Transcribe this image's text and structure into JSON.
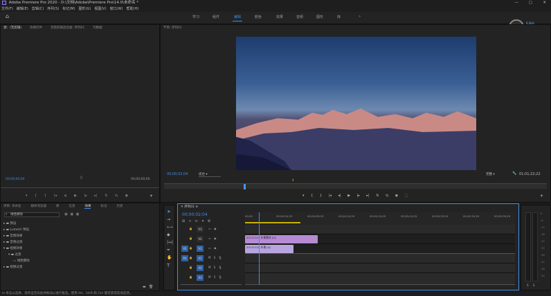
{
  "window": {
    "title": "Adobe Premiere Pro 2020 - D:\\文档\\Adobe\\Premiere Pro\\14.0\\未命名 *"
  },
  "menu": [
    "文件(F)",
    "编辑(E)",
    "剪辑(C)",
    "序列(S)",
    "标记(M)",
    "图形(G)",
    "视图(V)",
    "窗口(W)",
    "帮助(H)"
  ],
  "workspaces": [
    "学习",
    "组件",
    "编辑",
    "颜色",
    "效果",
    "音频",
    "图形",
    "库"
  ],
  "workspace_active_index": 2,
  "badge": {
    "percent": "48",
    "unit": "%",
    "up": "0.2k/s",
    "down": "0k/s"
  },
  "source_panel": {
    "tabs": [
      "源：(无剪辑)",
      "效果控件",
      "音频剪辑混合器: 序列01",
      "元数据"
    ],
    "timecode_left": "00;00;00;00",
    "timecode_right": "00;00;00;00"
  },
  "program_panel": {
    "title": "节目: 序列01",
    "timecode": "00;00;02;04",
    "fit": "适合",
    "quality": "完整",
    "duration": "01;01;22;22",
    "marker": "4"
  },
  "project_panel": {
    "tabs": [
      "项目: 未命名",
      "媒体浏览器",
      "库",
      "信息",
      "效果",
      "标记",
      "历史"
    ],
    "active_tab": "效果",
    "search": "线性擦除",
    "tree": [
      {
        "label": "预设",
        "indent": 0,
        "expanded": false
      },
      {
        "label": "Lumetri 预设",
        "indent": 0,
        "expanded": false
      },
      {
        "label": "音频效果",
        "indent": 0,
        "expanded": false
      },
      {
        "label": "音频过渡",
        "indent": 0,
        "expanded": false
      },
      {
        "label": "视频效果",
        "indent": 0,
        "expanded": true
      },
      {
        "label": "过渡",
        "indent": 1,
        "expanded": true
      },
      {
        "label": "线性擦除",
        "indent": 2,
        "expanded": false
      },
      {
        "label": "视频过渡",
        "indent": 0,
        "expanded": false
      }
    ]
  },
  "timeline": {
    "title": "序列01",
    "timecode": "00;00;02;04",
    "ruler": [
      "00;00",
      "00;00;04;29",
      "00;00;09;29",
      "00;00;14;29",
      "00;00;19;29",
      "00;00;24;29",
      "00;00;29;29",
      "00;00;34;29",
      "00;00;39;29"
    ],
    "tracks_video": [
      "V3",
      "V2",
      "V1"
    ],
    "tracks_audio": [
      "A1",
      "A2",
      "A3"
    ],
    "source_patch_v": "V1",
    "source_patch_a": "A1",
    "master": "主声道",
    "clips": [
      {
        "track": "V2",
        "label": "20171115 外景素材 [V]",
        "color": "#b58bd4",
        "start": 0.0,
        "end": 0.27
      },
      {
        "track": "V1",
        "label": "20171115 外景 [V]",
        "color": "#b8a5e0",
        "start": 0.0,
        "end": 0.18
      }
    ],
    "playhead": 0.05
  },
  "meter": {
    "labels": [
      "0",
      "-6",
      "-12",
      "-18",
      "-24",
      "-30",
      "-36",
      "-42",
      "-48",
      "-54"
    ],
    "bottom": [
      "S",
      "S"
    ]
  },
  "status": "单击以选择，或单击空白处并拖动以进行框选。使用 Alt、Shift 和 Ctrl 键可获得其他选项。"
}
